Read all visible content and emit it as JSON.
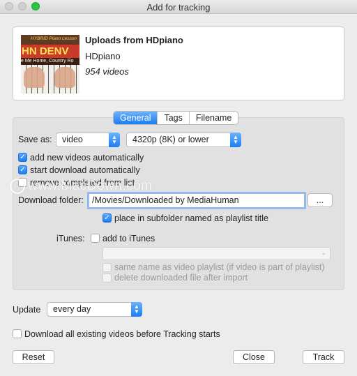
{
  "window": {
    "title": "Add for tracking"
  },
  "playlist": {
    "title": "Uploads from HDpiano",
    "author": "HDpiano",
    "video_count": "954 videos",
    "thumbnail_texts": {
      "top": "HYBRID Piano Lesson",
      "banner": "HN DENV",
      "subtitle": "e Me Home, Country Ro"
    }
  },
  "tabs": [
    {
      "label": "General",
      "active": true
    },
    {
      "label": "Tags",
      "active": false
    },
    {
      "label": "Filename",
      "active": false
    }
  ],
  "general": {
    "save_as_label": "Save as:",
    "format_value": "video",
    "quality_value": "4320p (8K) or lower",
    "add_new_videos": {
      "label": "add new videos automatically",
      "checked": true
    },
    "start_download": {
      "label": "start download automatically",
      "checked": true
    },
    "remove_completed": {
      "label": "remove completed from list",
      "checked": false
    },
    "download_folder_label": "Download folder:",
    "download_folder_value": "/Movies/Downloaded by MediaHuman",
    "browse_label": "...",
    "subfolder": {
      "label": "place in subfolder named as playlist title",
      "checked": true
    },
    "itunes_label": "iTunes:",
    "add_to_itunes": {
      "label": "add to iTunes",
      "checked": false
    },
    "itunes_playlist_value": "",
    "same_name": {
      "label": "same name as video playlist (if video is part of playlist)",
      "checked": false,
      "enabled": false
    },
    "delete_after_import": {
      "label": "delete downloaded file after import",
      "checked": false,
      "enabled": false
    }
  },
  "update": {
    "label": "Update",
    "value": "every day"
  },
  "download_all": {
    "label": "Download all existing videos before Tracking starts",
    "checked": false
  },
  "buttons": {
    "reset": "Reset",
    "close": "Close",
    "track": "Track"
  },
  "watermark": {
    "text": "www.MacDown.com"
  },
  "colors": {
    "accent": "#1c7cf4",
    "panel": "#e1e1e1",
    "window": "#ececec"
  }
}
